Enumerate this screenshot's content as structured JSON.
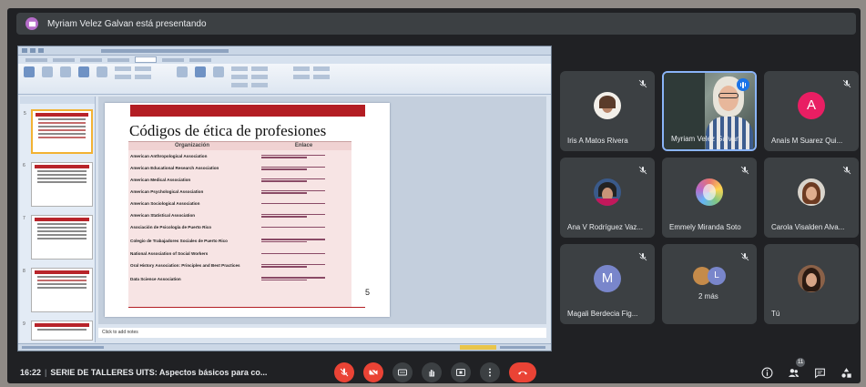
{
  "banner": {
    "text": "Myriam Velez Galvan está presentando"
  },
  "slide": {
    "title": "Códigos de ética de profesiones",
    "col_org": "Organización",
    "col_link": "Enlace",
    "rows": [
      "American Anthropological Association",
      "American Educational Research Association",
      "American Medical Association",
      "American Psychological Association",
      "American Sociological Association",
      "American Statistical Association",
      "Asociación de Psicología de Puerto Rico",
      "Colegio de Trabajadores Sociales de Puerto Rico",
      "National Association of Social Workers",
      "Oral History Association: Principles and Best Practices",
      "Data Science Association"
    ],
    "page_number": "5",
    "notes_placeholder": "Click to add notes"
  },
  "participants": [
    {
      "name": "Iris A Matos Rivera",
      "type": "photo",
      "bg": "#f2efe9"
    },
    {
      "name": "Myriam Velez Galvan",
      "type": "video",
      "speaking": true
    },
    {
      "name": "Anaís M Suarez Qui...",
      "type": "letter",
      "letter": "A",
      "color": "#e91e63"
    },
    {
      "name": "Ana V Rodríguez Vaz...",
      "type": "photo",
      "bg": "#3a5a8a"
    },
    {
      "name": "Emmely Miranda Soto",
      "type": "photo",
      "bg": "#6aa7d8"
    },
    {
      "name": "Carola Visalden Alva...",
      "type": "photo",
      "bg": "#d9d4cc"
    },
    {
      "name": "Magali Berdecia Fig...",
      "type": "letter",
      "letter": "M",
      "color": "#7986cb"
    },
    {
      "name": "",
      "type": "more",
      "label": "2 más",
      "letter": "L"
    },
    {
      "name": "Tú",
      "type": "photo",
      "bg": "#a57a5c"
    }
  ],
  "bottom": {
    "time": "16:22",
    "separator": "|",
    "meeting_title": "SERIE DE TALLERES UITS: Aspectos básicos para co...",
    "people_count": "11"
  }
}
